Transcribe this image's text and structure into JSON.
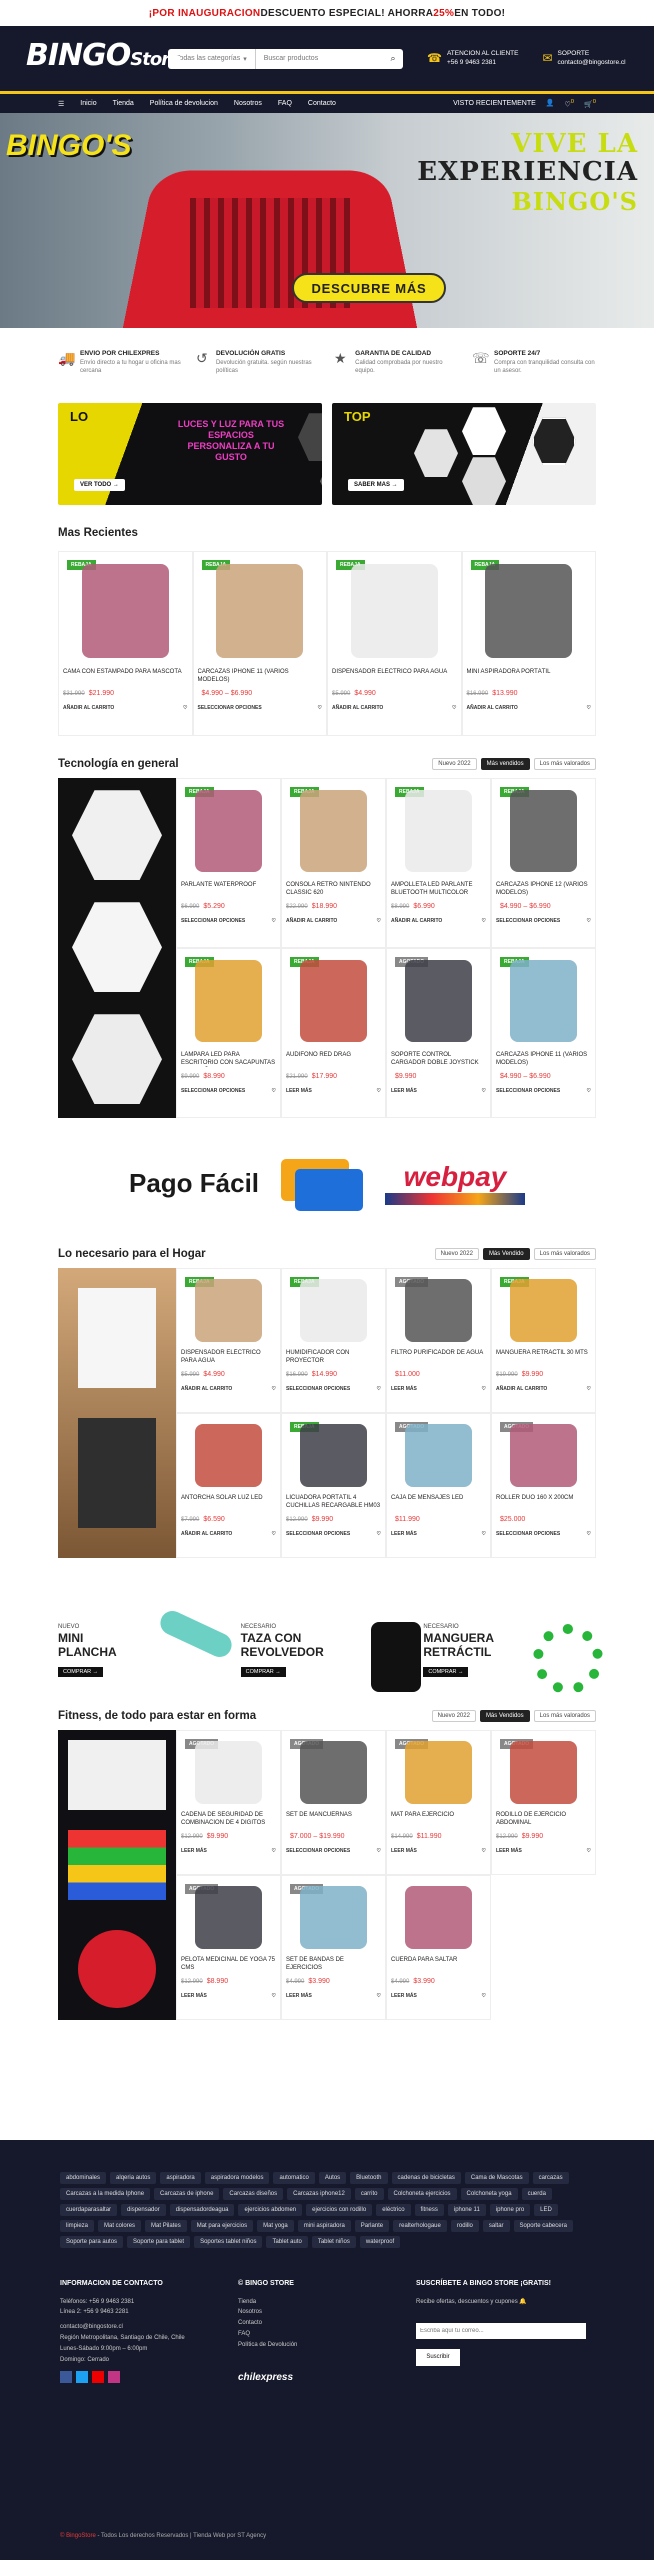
{
  "topbar": {
    "prefix": "¡POR INAUGURACION",
    "middle": " DESCUENTO ESPECIAL! AHORRA ",
    "pct": "25%",
    "suffix": " EN TODO!"
  },
  "header": {
    "logo": "BINGO'S Store",
    "search_cat": "Todas las categorías",
    "search_ph": "Buscar productos",
    "attention_title": "ATENCION AL CLIENTE",
    "attention_phone": "+56 9 9463 2381",
    "support_title": "SOPORTE",
    "support_email": "contacto@bingostore.cl"
  },
  "nav": {
    "items": [
      "Inicio",
      "Tienda",
      "Política de devolucion",
      "Nosotros",
      "FAQ",
      "Contacto"
    ],
    "recent": "VISTO RECIENTEMENTE",
    "cart_count": "0",
    "wish_count": "0"
  },
  "hero": {
    "logo": "BINGO'S",
    "l1": "VIVE LA",
    "l2": "EXPERIENCIA",
    "l3": "BINGO'S",
    "cta": "DESCUBRE MÁS"
  },
  "features": [
    {
      "title": "ENVIO POR CHILEXPRES",
      "text": "Envío directo a tu hogar u oficina mas cercana"
    },
    {
      "title": "DEVOLUCIÓN GRATIS",
      "text": "Devolución gratuita. según nuestras políticas"
    },
    {
      "title": "GARANTIA DE CALIDAD",
      "text": "Calidad comprobada por nuestro equipo."
    },
    {
      "title": "SOPORTE 24/7",
      "text": "Compra con tranquilidad consulta con un asesor."
    }
  ],
  "banners": [
    {
      "tag": "LO",
      "mid": "LUCES Y LUZ PARA TUS ESPACIOS PERSONALIZA A TU GUSTO",
      "btn": "VER TODO →"
    },
    {
      "tag": "TOP",
      "mid": "",
      "btn": "SABER MAS →"
    }
  ],
  "recientes": {
    "title": "Mas Recientes",
    "items": [
      {
        "tag": "REBAJA",
        "name": "CAMA CON ESTAMPADO PARA MASCOTA",
        "old": "$31.990",
        "new": "$21.990",
        "btn": "AÑADIR AL CARRITO"
      },
      {
        "tag": "REBAJA",
        "name": "CARCAZAS IPHONE 11 (VARIOS MODELOS)",
        "old": "",
        "new": "$4.990 – $6.990",
        "btn": "SELECCIONAR OPCIONES"
      },
      {
        "tag": "REBAJA",
        "name": "Dispensador eléctrico para agua",
        "old": "$5.990",
        "new": "$4.990",
        "btn": "AÑADIR AL CARRITO"
      },
      {
        "tag": "REBAJA",
        "name": "MINI ASPIRADORA PORTÁTIL",
        "old": "$16.990",
        "new": "$13.990",
        "btn": "AÑADIR AL CARRITO"
      }
    ]
  },
  "tech": {
    "title": "Tecnología en general",
    "filters": [
      "Nuevo 2022",
      "Más vendidos",
      "Los más valorados"
    ],
    "items": [
      {
        "tag": "REBAJA",
        "name": "PARLANTE WATERPROOF",
        "old": "$6.990",
        "new": "$5.290",
        "btn": "SELECCIONAR OPCIONES"
      },
      {
        "tag": "REBAJA",
        "name": "CONSOLA RETRO NINTENDO CLASSIC 620",
        "old": "$22.990",
        "new": "$18.990",
        "btn": "AÑADIR AL CARRITO"
      },
      {
        "tag": "REBAJA",
        "name": "Ampolleta Led Parlante Bluetooth Multicolor",
        "old": "$8.990",
        "new": "$6.990",
        "btn": "AÑADIR AL CARRITO"
      },
      {
        "tag": "REBAJA",
        "name": "CARCAZAS IPHONE 12 (VARIOS MODELOS)",
        "old": "",
        "new": "$4.990 – $6.990",
        "btn": "SELECCIONAR OPCIONES"
      },
      {
        "tag": "REBAJA",
        "name": "Lámpara Led Para Escritorio Con Sacapuntas Para Niños",
        "old": "$9.990",
        "new": "$8.990",
        "btn": "SELECCIONAR OPCIONES"
      },
      {
        "tag": "REBAJA",
        "name": "AUDIFONO RED DRAG",
        "old": "$21.990",
        "new": "$17.990",
        "btn": "LEER MÁS"
      },
      {
        "tag": "AGOTADO",
        "name": "SOPORTE CONTROL CARGADOR DOBLE JOYSTICK",
        "old": "",
        "new": "$9.990",
        "btn": "LEER MÁS"
      },
      {
        "tag": "REBAJA",
        "name": "CARCAZAS IPHONE 11 (VARIOS MODELOS)",
        "old": "",
        "new": "$4.990 – $6.990",
        "btn": "SELECCIONAR OPCIONES"
      }
    ]
  },
  "pagos": {
    "pf": "Pago Fácil",
    "wp": "webpay"
  },
  "hogar": {
    "title": "Lo necesario para el Hogar",
    "filters": [
      "Nuevo 2022",
      "Más Vendido",
      "Los más valorados"
    ],
    "items": [
      {
        "tag": "REBAJA",
        "name": "Dispensador eléctrico para agua",
        "old": "$5.990",
        "new": "$4.990",
        "btn": "AÑADIR AL CARRITO"
      },
      {
        "tag": "REBAJA",
        "name": "HUMIDIFICADOR CON PROYECTOR",
        "old": "$16.990",
        "new": "$14.990",
        "btn": "SELECCIONAR OPCIONES"
      },
      {
        "tag": "AGOTADO",
        "name": "FILTRO PURIFICADOR DE AGUA",
        "old": "",
        "new": "$11.000",
        "btn": "LEER MÁS"
      },
      {
        "tag": "REBAJA",
        "name": "MANGUERA RETRACTIL 30 MTS",
        "old": "$19.990",
        "new": "$9.990",
        "btn": "AÑADIR AL CARRITO"
      },
      {
        "tag": "",
        "name": "ANTORCHA SOLAR LUZ LED",
        "old": "$7.990",
        "new": "$6.590",
        "btn": "AÑADIR AL CARRITO"
      },
      {
        "tag": "REBAJA",
        "name": "Licuadora Portátil 4 Cuchillas Recargable HM03",
        "old": "$12.990",
        "new": "$9.990",
        "btn": "SELECCIONAR OPCIONES"
      },
      {
        "tag": "AGOTADO",
        "name": "CAJA DE MENSAJES LED",
        "old": "",
        "new": "$11.990",
        "btn": "LEER MÁS"
      },
      {
        "tag": "AGOTADO",
        "name": "ROLLER DUO 160 x 200cm",
        "old": "",
        "new": "$25.000",
        "btn": "SELECCIONAR OPCIONES"
      }
    ]
  },
  "promo": [
    {
      "small": "NUEVO",
      "title": "MINI PLANCHA",
      "btn": "COMPRAR →"
    },
    {
      "small": "NECESARIO",
      "title": "TAZA CON REVOLVEDOR",
      "btn": "COMPRAR →"
    },
    {
      "small": "NECESARIO",
      "title": "MANGUERA RETRÁCTIL",
      "btn": "COMPRAR →"
    }
  ],
  "fitness": {
    "title": "Fitness, de todo para estar en forma",
    "filters": [
      "Nuevo 2022",
      "Más Vendidos",
      "Los más valorados"
    ],
    "items": [
      {
        "tag": "AGOTADO",
        "name": "CADENA DE SEGURIDAD DE COMBINACION DE 4 DIGITOS",
        "old": "$12.990",
        "new": "$9.990",
        "btn": "LEER MÁS"
      },
      {
        "tag": "AGOTADO",
        "name": "SET DE MANCUERNAS",
        "old": "",
        "new": "$7.000 – $19.990",
        "btn": "SELECCIONAR OPCIONES"
      },
      {
        "tag": "AGOTADO",
        "name": "MAT PARA EJERCICIO",
        "old": "$14.990",
        "new": "$11.990",
        "btn": "LEER MÁS"
      },
      {
        "tag": "AGOTADO",
        "name": "RODILLO DE EJERCICIO ABDOMINAL",
        "old": "$12.990",
        "new": "$9.990",
        "btn": "LEER MÁS"
      },
      {
        "tag": "AGOTADO",
        "name": "PELOTA MEDICINAL DE YOGA 75 CMS",
        "old": "$12.990",
        "new": "$8.990",
        "btn": "LEER MÁS"
      },
      {
        "tag": "AGOTADO",
        "name": "SET DE BANDAS DE EJERCICIOS",
        "old": "$4.990",
        "new": "$3.990",
        "btn": "LEER MÁS"
      },
      {
        "tag": "",
        "name": "CUERDA PARA SALTAR",
        "old": "$4.990",
        "new": "$3.990",
        "btn": "LEER MÁS"
      }
    ]
  },
  "footer": {
    "tags": [
      "abdominales",
      "alqeria autos",
      "aspiradora",
      "aspiradora modelos",
      "automatico",
      "Autos",
      "Bluetooth",
      "cadenas de bicicletas",
      "Cama de Mascotas",
      "carcazas",
      "Carcazas a la medida Iphone",
      "Carcazas de iphone",
      "Carcazas diseños",
      "Carcazas iphone12",
      "carrito",
      "Colchoneta ejercicios",
      "Colchoneta yoga",
      "cuerda",
      "cuerdaparasaltar",
      "dispensador",
      "dispensadordeagua",
      "ejercicios abdomen",
      "ejercicios con rodillo",
      "eléctrico",
      "fitness",
      "iphone 11",
      "iphone pro",
      "LED",
      "limpieza",
      "Mat colores",
      "Mat Pilates",
      "Mat para ejercicios",
      "Mat yoga",
      "mini aspiradora",
      "Parlante",
      "realterhologaue",
      "rodillo",
      "saltar",
      "Soporte cabecera",
      "Soporte para autos",
      "Soporte para tablet",
      "Soportes tablet niños",
      "Tablet auto",
      "Tablet niños",
      "waterproof"
    ],
    "contact_title": "INFORMACION DE CONTACTO",
    "phone": "Teléfonos: +56 9 9463 2381",
    "phone2": "Línea 2: +56 9 9463 2281",
    "email": "contacto@bingostore.cl",
    "region": "Región Metropolitana, Santiago de Chile, Chile",
    "hours": "Lunes-Sábado 9:00pm – 6:00pm",
    "hours2": "Domingo: Cerrado",
    "store_title": "© BINGO STORE",
    "store_links": [
      "Tienda",
      "Nosotros",
      "Contacto",
      "FAQ",
      "Política de Devolución"
    ],
    "news_title": "SUSCRÍBETE A BINGO STORE ¡GRATIS!",
    "news_text": "Recibe ofertas, descuentos y cupones 🔔",
    "news_ph": "Escriba aquí tu correo...",
    "news_btn": "Suscribir",
    "chx": "chilexpress",
    "copy_brand": "© BingoStore",
    "copy_rest": " - Todos Los derechos Reservados | Tienda Web por ST Agency"
  }
}
